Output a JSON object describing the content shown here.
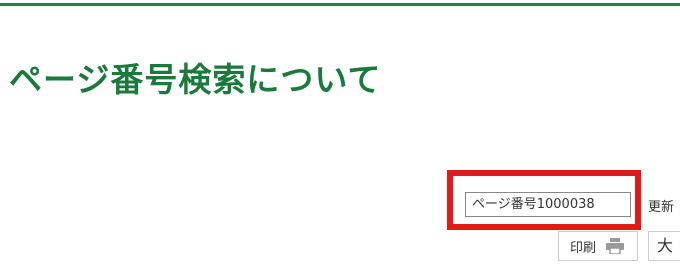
{
  "header": {
    "accent_color": "#1a8a46"
  },
  "main": {
    "title": "ページ番号検索について",
    "title_color": "#1a7a3c"
  },
  "meta": {
    "page_number": "ページ番号1000038",
    "updated_label": "更新",
    "highlight_color": "#e11a1a"
  },
  "tools": {
    "print_label": "印刷",
    "print_icon": "printer-icon",
    "font_size_label": "大"
  }
}
